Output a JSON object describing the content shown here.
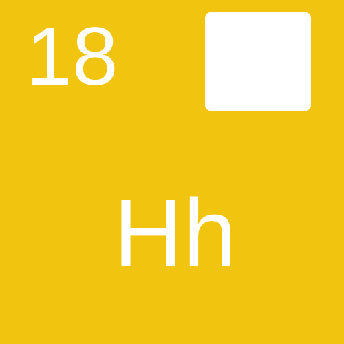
{
  "tile": {
    "number": "18",
    "symbol": "Hh",
    "background_color": "#F1C40F",
    "foreground_color": "#FFFFFF"
  }
}
